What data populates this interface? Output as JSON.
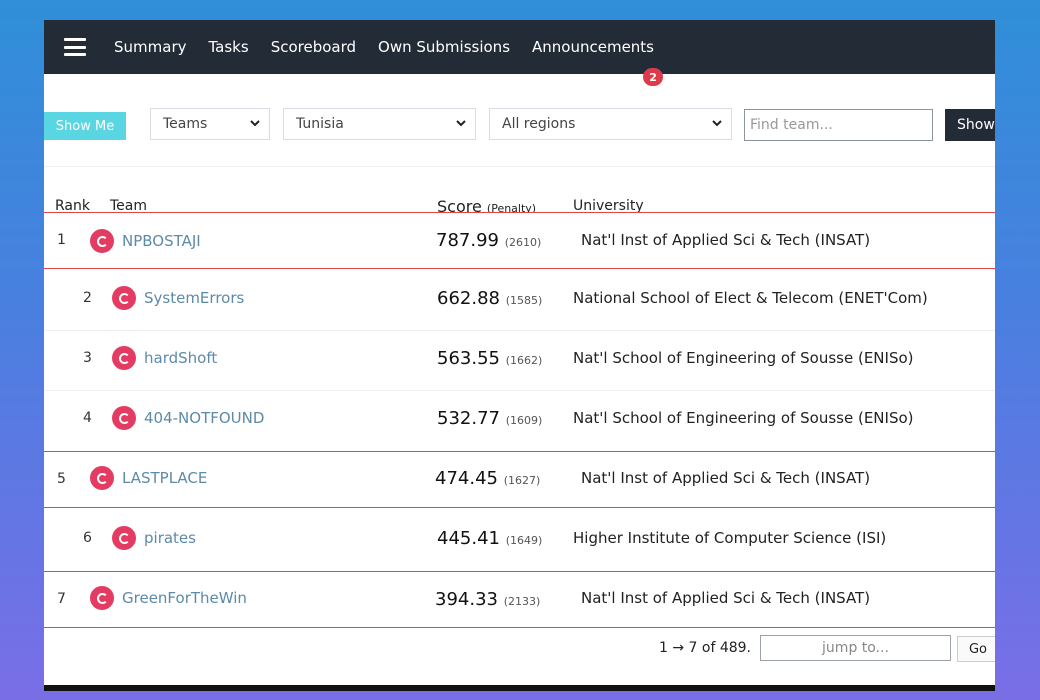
{
  "nav": {
    "links": [
      "Summary",
      "Tasks",
      "Scoreboard",
      "Own Submissions",
      "Announcements"
    ],
    "announcements_badge": "2"
  },
  "filters": {
    "show_me_label": "Show Me",
    "group_select": "Teams",
    "country_select": "Tunisia",
    "region_select": "All regions",
    "find_placeholder": "Find team...",
    "show_label": "Show"
  },
  "table": {
    "headers": {
      "rank": "Rank",
      "team": "Team",
      "score": "Score",
      "penalty": "(Penalty)",
      "university": "University"
    },
    "rows": [
      {
        "rank": "1",
        "team": "NPBOSTAJI",
        "score": "787.99",
        "penalty": "(2610)",
        "university": "Nat'l Inst of Applied Sci & Tech (INSAT)",
        "highlighted": true
      },
      {
        "rank": "2",
        "team": "SystemErrors",
        "score": "662.88",
        "penalty": "(1585)",
        "university": "National School of Elect & Telecom (ENET'Com)",
        "highlighted": false
      },
      {
        "rank": "3",
        "team": "hardShoft",
        "score": "563.55",
        "penalty": "(1662)",
        "university": "Nat'l School of Engineering of Sousse (ENISo)",
        "highlighted": false
      },
      {
        "rank": "4",
        "team": "404-NOTFOUND",
        "score": "532.77",
        "penalty": "(1609)",
        "university": "Nat'l School of Engineering of Sousse (ENISo)",
        "highlighted": false
      },
      {
        "rank": "5",
        "team": "LASTPLACE",
        "score": "474.45",
        "penalty": "(1627)",
        "university": "Nat'l Inst of Applied Sci & Tech (INSAT)",
        "highlighted": true
      },
      {
        "rank": "6",
        "team": "pirates",
        "score": "445.41",
        "penalty": "(1649)",
        "university": "Higher Institute of Computer Science (ISI)",
        "highlighted": false
      },
      {
        "rank": "7",
        "team": "GreenForTheWin",
        "score": "394.33",
        "penalty": "(2133)",
        "university": "Nat'l Inst of Applied Sci & Tech (INSAT)",
        "highlighted": true
      }
    ]
  },
  "pager": {
    "range": "1 → 7 of 489.",
    "jump_placeholder": "jump to...",
    "go_label": "Go"
  },
  "colors": {
    "navbar": "#232c36",
    "show_me_button": "#5ad6e3",
    "team_link": "#5d8aa8",
    "team_icon": "#e33b62",
    "highlight_border": "#e04848",
    "badge": "#dd3a4c"
  }
}
